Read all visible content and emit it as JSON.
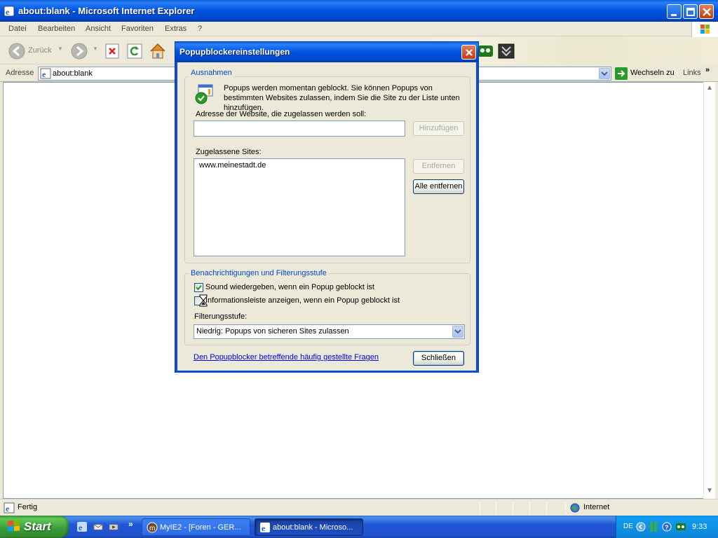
{
  "window": {
    "title": "about:blank - Microsoft Internet Explorer"
  },
  "menu": [
    "Datei",
    "Bearbeiten",
    "Ansicht",
    "Favoriten",
    "Extras",
    "?"
  ],
  "toolbar": {
    "back_label": "Zurück"
  },
  "address": {
    "label": "Adresse",
    "value": "about:blank",
    "go_label": "Wechseln zu",
    "links_label": "Links",
    "links_chevron": "»"
  },
  "status": {
    "text": "Fertig",
    "zone": "Internet"
  },
  "taskbar": {
    "start_label": "Start",
    "tasks": [
      {
        "label": "MyIE2 - [Foren - GER..."
      },
      {
        "label": "about:blank - Microso..."
      }
    ],
    "overflow": "»",
    "language": "DE",
    "clock": "9:33"
  },
  "dialog": {
    "title": "Popupblockereinstellungen",
    "exceptions_group": "Ausnahmen",
    "info_text": "Popups werden momentan geblockt. Sie können Popups von bestimmten Websites zulassen, indem Sie die Site zu der Liste unten hinzufügen.",
    "address_label": "Adresse der Website, die zugelassen werden soll:",
    "address_value": "",
    "add_button": "Hinzufügen",
    "allowed_label": "Zugelassene Sites:",
    "allowed_sites": [
      "www.meinestadt.de"
    ],
    "remove_button": "Entfernen",
    "remove_all_button": "Alle entfernen",
    "notify_group": "Benachrichtigungen und Filterungsstufe",
    "sound_label": "Sound wiedergeben, wenn ein Popup geblockt ist",
    "sound_checked": true,
    "infobar_label": "Informationsleiste anzeigen, wenn ein Popup geblockt ist",
    "infobar_checked": false,
    "filter_label": "Filterungsstufe:",
    "filter_value": "Niedrig: Popups von sicheren Sites zulassen",
    "faq_link": "Den Popupblocker betreffende häufig gestellte Fragen",
    "close_button": "Schließen"
  }
}
